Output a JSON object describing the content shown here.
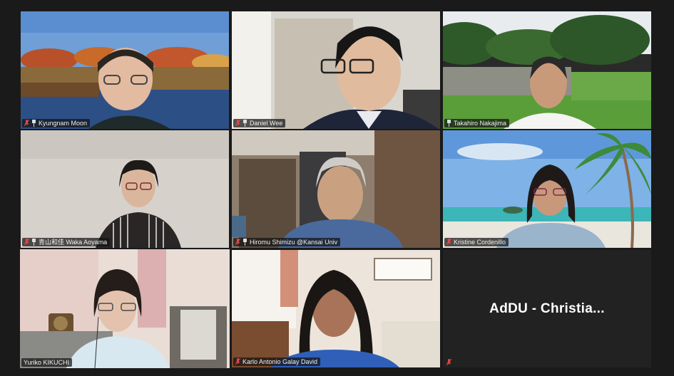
{
  "participants": [
    {
      "name": "Kyungnam Moon",
      "muted": true,
      "pinned": true
    },
    {
      "name": "Daniel Wee",
      "muted": true,
      "pinned": true
    },
    {
      "name": "Takahiro Nakajima",
      "muted": false,
      "pinned": true
    },
    {
      "name": "青山和佳 Waka Aoyama",
      "muted": true,
      "pinned": true
    },
    {
      "name": "Hiromu Shimizu @Kansai Univ",
      "muted": true,
      "pinned": true
    },
    {
      "name": "Kristine Cordenillo",
      "muted": true,
      "pinned": false
    },
    {
      "name": "Yuriko KIKUCHI",
      "muted": false,
      "pinned": false,
      "active_speaker": true
    },
    {
      "name": "Karlo Antonio Galay David",
      "muted": true,
      "pinned": false
    },
    {
      "name": "AdDU - Christia...",
      "muted": true,
      "pinned": false,
      "video_off": true
    }
  ],
  "colors": {
    "background": "#1a1a1a",
    "active_speaker_border": "#cde05a",
    "muted_icon": "#e04848"
  }
}
